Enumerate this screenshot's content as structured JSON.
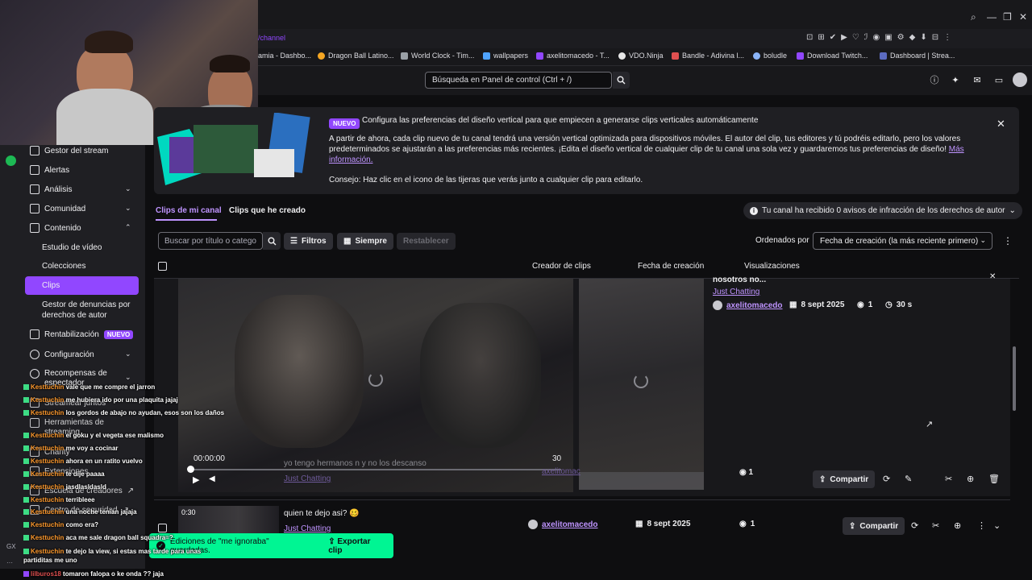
{
  "browser": {
    "url_fragment": "/channel",
    "bookmarks": [
      {
        "label": "amia - Dashbo...",
        "color": "#6b6b72"
      },
      {
        "label": "Dragon Ball Latino...",
        "color": "#f5a623"
      },
      {
        "label": "World Clock - Tim...",
        "color": "#9aa0a6"
      },
      {
        "label": "wallpapers",
        "color": "#4fa3ff"
      },
      {
        "label": "axelitomacedo - T...",
        "color": "#9147ff"
      },
      {
        "label": "VDO.Ninja",
        "color": "#e8e8e8"
      },
      {
        "label": "Bandle - Adivina l...",
        "color": "#e05050"
      },
      {
        "label": "boludle",
        "color": "#8ab4f8"
      },
      {
        "label": "Download Twitch...",
        "color": "#9147ff"
      },
      {
        "label": "Dashboard | Strea...",
        "color": "#5c6bc0"
      }
    ]
  },
  "topnav": {
    "search_placeholder": "Búsqueda en Panel de control (Ctrl + /)"
  },
  "sidebar": {
    "items": [
      {
        "label": "Gestor del stream"
      },
      {
        "label": "Alertas"
      },
      {
        "label": "Análisis"
      },
      {
        "label": "Comunidad"
      },
      {
        "label": "Contenido"
      },
      {
        "label": "Rentabilización",
        "badge": "NUEVO"
      },
      {
        "label": "Configuración"
      },
      {
        "label": "Recompensas de espectador"
      },
      {
        "label": "Streamear juntos"
      },
      {
        "label": "Herramientas de streaming"
      },
      {
        "label": "Charity"
      },
      {
        "label": "Extensiones"
      },
      {
        "label": "Escuela de creadores"
      },
      {
        "label": "Centro de seguridad"
      }
    ],
    "content_subitems": [
      {
        "label": "Estudio de vídeo"
      },
      {
        "label": "Colecciones"
      },
      {
        "label": "Clips"
      },
      {
        "label": "Gestor de denuncias por derechos de autor"
      }
    ]
  },
  "banner": {
    "badge": "NUEVO",
    "title": "Configura las preferencias del diseño vertical para que empiecen a generarse clips verticales automáticamente",
    "body": "A partir de ahora, cada clip nuevo de tu canal tendrá una versión vertical optimizada para dispositivos móviles. El autor del clip, tus editores y tú podréis editarlo, pero los valores predeterminados se ajustarán a las preferencias más recientes. ¡Edita el diseño vertical de cualquier clip de tu canal una sola vez y guardaremos tus preferencias de diseño!",
    "link": "Más información.",
    "tip": "Consejo: Haz clic en el icono de las tijeras que verás junto a cualquier clip para editarlo."
  },
  "tabs": {
    "mine": "Clips de mi canal",
    "created": "Clips que he creado",
    "copyright_notice": "Tu canal ha recibido 0 avisos de infracción de los derechos de autor"
  },
  "filters": {
    "search_placeholder": "Buscar por título o categoría",
    "filters_label": "Filtros",
    "period_label": "Siempre",
    "reset_label": "Restablecer",
    "sort_label": "Ordenados por",
    "sort_value": "Fecha de creación (la más reciente primero)"
  },
  "table": {
    "headers": {
      "creator": "Creador de clips",
      "date": "Fecha de creación",
      "views": "Visualizaciones"
    }
  },
  "expanded_clip": {
    "title": "nosotros no...",
    "title_ghost": "yo tengo hermanos n y no los descanso",
    "category": "Just Chatting",
    "creator": "axelitomacedo",
    "creator_ghost": "axelitomac",
    "date": "8 sept 2025",
    "views": "1",
    "duration": "30 s",
    "time_current": "00:00:00",
    "time_end": "30",
    "share_label": "Compartir"
  },
  "clip_row_2": {
    "duration_badge": "0:30",
    "title": "quien te dejo asi? 🥴",
    "category": "Just Chatting",
    "creator": "axelitomacedo",
    "date": "8 sept 2025",
    "views": "1",
    "share_label": "Compartir"
  },
  "toast": {
    "message": "Ediciones de \"me ignoraba\" guardadas.",
    "action": "Exportar clip"
  },
  "chat": [
    {
      "user": "Kesttuchin",
      "msg": "vale que me compre el jarron"
    },
    {
      "user": "Kesttuchin",
      "msg": "me hubiera ido por una plaquita jajaj"
    },
    {
      "user": "Kesttuchin",
      "msg": "los gordos de abajo no ayudan, esos son los daños"
    },
    {
      "user": "Kesttuchin",
      "msg": "el goku y el vegeta ese malismo"
    },
    {
      "user": "Kesttuchin",
      "msg": "me voy a cocinar"
    },
    {
      "user": "Kesttuchin",
      "msg": "ahora en un ratito vuelvo"
    },
    {
      "user": "Kesttuchin",
      "msg": "te dije paaaa"
    },
    {
      "user": "Kesttuchin",
      "msg": "jasdlasldasld"
    },
    {
      "user": "Kesttuchin",
      "msg": "terribleee"
    },
    {
      "user": "Kesttuchin",
      "msg": "una noche tenian jajaja"
    },
    {
      "user": "Kesttuchin",
      "msg": "como era?"
    },
    {
      "user": "Kesttuchin",
      "msg": "aca me sale dragon ball squadra=?"
    },
    {
      "user": "Kesttuchin",
      "msg": "te dejo la view, si estas mas tarde para unas partiditas me uno"
    },
    {
      "user": "lilburos18",
      "msg": "tomaron falopa o ke onda ?? jaja"
    }
  ],
  "gutter": {
    "gx": "GX"
  },
  "colors": {
    "accent": "#9147ff",
    "link": "#bf94ff",
    "toast": "#00f593"
  }
}
